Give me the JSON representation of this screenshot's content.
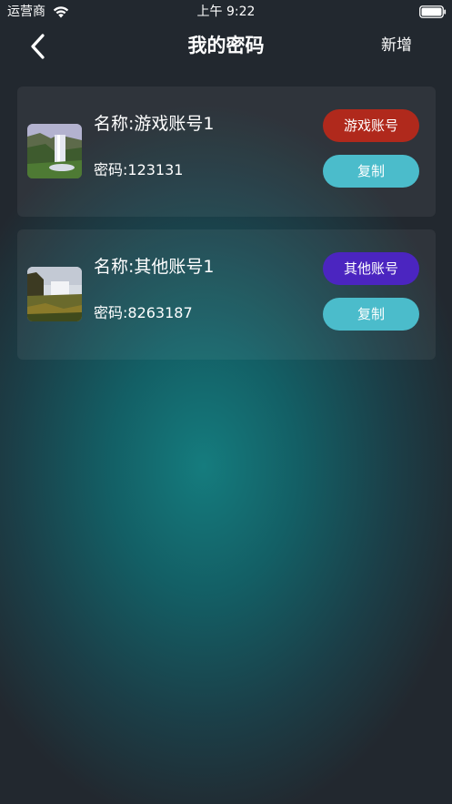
{
  "status_bar": {
    "carrier": "运营商",
    "time": "上午 9:22",
    "wifi_icon": "wifi-icon",
    "battery_icon": "battery-icon"
  },
  "nav": {
    "back_icon": "chevron-left-icon",
    "title": "我的密码",
    "add_label": "新增"
  },
  "colors": {
    "game_tag": "#b0291c",
    "other_tag": "#4b25c0",
    "copy_button": "#4bbccb",
    "background_center": "#157c7e",
    "background_edge": "#22282f"
  },
  "entries": [
    {
      "name": "名称:游戏账号1",
      "password": "密码:123131",
      "tag": "游戏账号",
      "tag_color": "#b0291c",
      "copy_label": "复制",
      "thumbnail": "waterfall-thumbnail"
    },
    {
      "name": "名称:其他账号1",
      "password": "密码:8263187",
      "tag": "其他账号",
      "tag_color": "#4b25c0",
      "copy_label": "复制",
      "thumbnail": "waterfall-thumbnail"
    }
  ]
}
